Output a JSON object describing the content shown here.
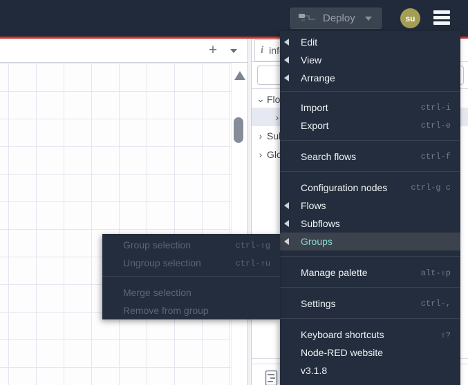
{
  "colors": {
    "header_bg": "#212a3b",
    "accent_red": "#d4322c",
    "menu_bg": "#232d3d",
    "menu_highlight_bg": "#3d434d",
    "menu_highlight_text": "#85d7d5",
    "avatar_bg": "#a49e52",
    "selected_row_bg": "#e7e9f2"
  },
  "header": {
    "deploy_label": "Deploy",
    "avatar_text": "su"
  },
  "canvas_toolbar": {
    "add_flow_glyph": "+"
  },
  "sidebar": {
    "info_tab_label": "info",
    "tree": {
      "chevron_down_glyph": "⌄",
      "chevron_right_glyph": "›",
      "flows_label": "Flows",
      "selected_item_label": "",
      "subflows_label": "Subflows",
      "global_label": "Global Configuration Nodes"
    }
  },
  "menu": {
    "sections": [
      {
        "items": [
          {
            "label": "Edit",
            "submenu": true
          },
          {
            "label": "View",
            "submenu": true
          },
          {
            "label": "Arrange",
            "submenu": true
          }
        ]
      },
      {
        "items": [
          {
            "label": "Import",
            "shortcut": "ctrl-i"
          },
          {
            "label": "Export",
            "shortcut": "ctrl-e"
          }
        ]
      },
      {
        "items": [
          {
            "label": "Search flows",
            "shortcut": "ctrl-f"
          }
        ]
      },
      {
        "items": [
          {
            "label": "Configuration nodes",
            "shortcut": "ctrl-g c"
          },
          {
            "label": "Flows",
            "submenu": true
          },
          {
            "label": "Subflows",
            "submenu": true
          },
          {
            "label": "Groups",
            "submenu": true,
            "active": true
          }
        ]
      },
      {
        "items": [
          {
            "label": "Manage palette",
            "shortcut": "alt-⇧p"
          }
        ]
      },
      {
        "items": [
          {
            "label": "Settings",
            "shortcut": "ctrl-,"
          }
        ]
      },
      {
        "items": [
          {
            "label": "Keyboard shortcuts",
            "shortcut": "⇧?"
          },
          {
            "label": "Node-RED website"
          },
          {
            "label": "v3.1.8"
          }
        ]
      }
    ]
  },
  "submenu": {
    "sections": [
      {
        "items": [
          {
            "label": "Group selection",
            "shortcut": "ctrl-⇧g",
            "disabled": true
          },
          {
            "label": "Ungroup selection",
            "shortcut": "ctrl-⇧u",
            "disabled": true
          }
        ]
      },
      {
        "items": [
          {
            "label": "Merge selection",
            "disabled": true
          },
          {
            "label": "Remove from group",
            "disabled": true
          }
        ]
      }
    ]
  }
}
